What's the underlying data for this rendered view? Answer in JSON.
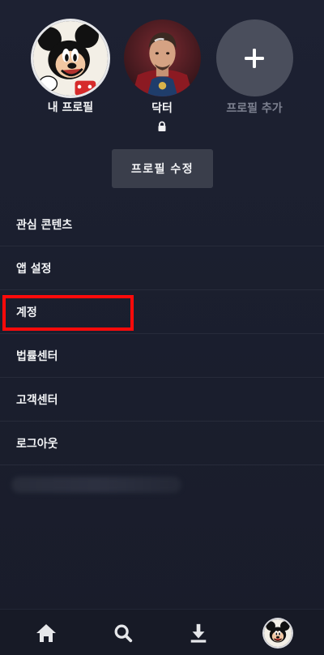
{
  "profiles": [
    {
      "name": "내 프로필",
      "avatar": "mickey-avatar",
      "selected": true
    },
    {
      "name": "닥터",
      "avatar": "doctor-avatar",
      "locked": true
    },
    {
      "name": "프로필 추가",
      "avatar": "add-icon"
    }
  ],
  "edit_profile_label": "프로필 수정",
  "menu": [
    {
      "label": "관심 콘텐츠"
    },
    {
      "label": "앱 설정"
    },
    {
      "label": "계정"
    },
    {
      "label": "법률센터"
    },
    {
      "label": "고객센터"
    },
    {
      "label": "로그아웃"
    }
  ],
  "bottom_nav": [
    {
      "icon": "home-icon"
    },
    {
      "icon": "search-icon"
    },
    {
      "icon": "download-icon"
    },
    {
      "icon": "profile-avatar"
    }
  ],
  "colors": {
    "background": "#1d2132",
    "highlight": "#ff0a0a",
    "button": "#3a3e4b"
  }
}
